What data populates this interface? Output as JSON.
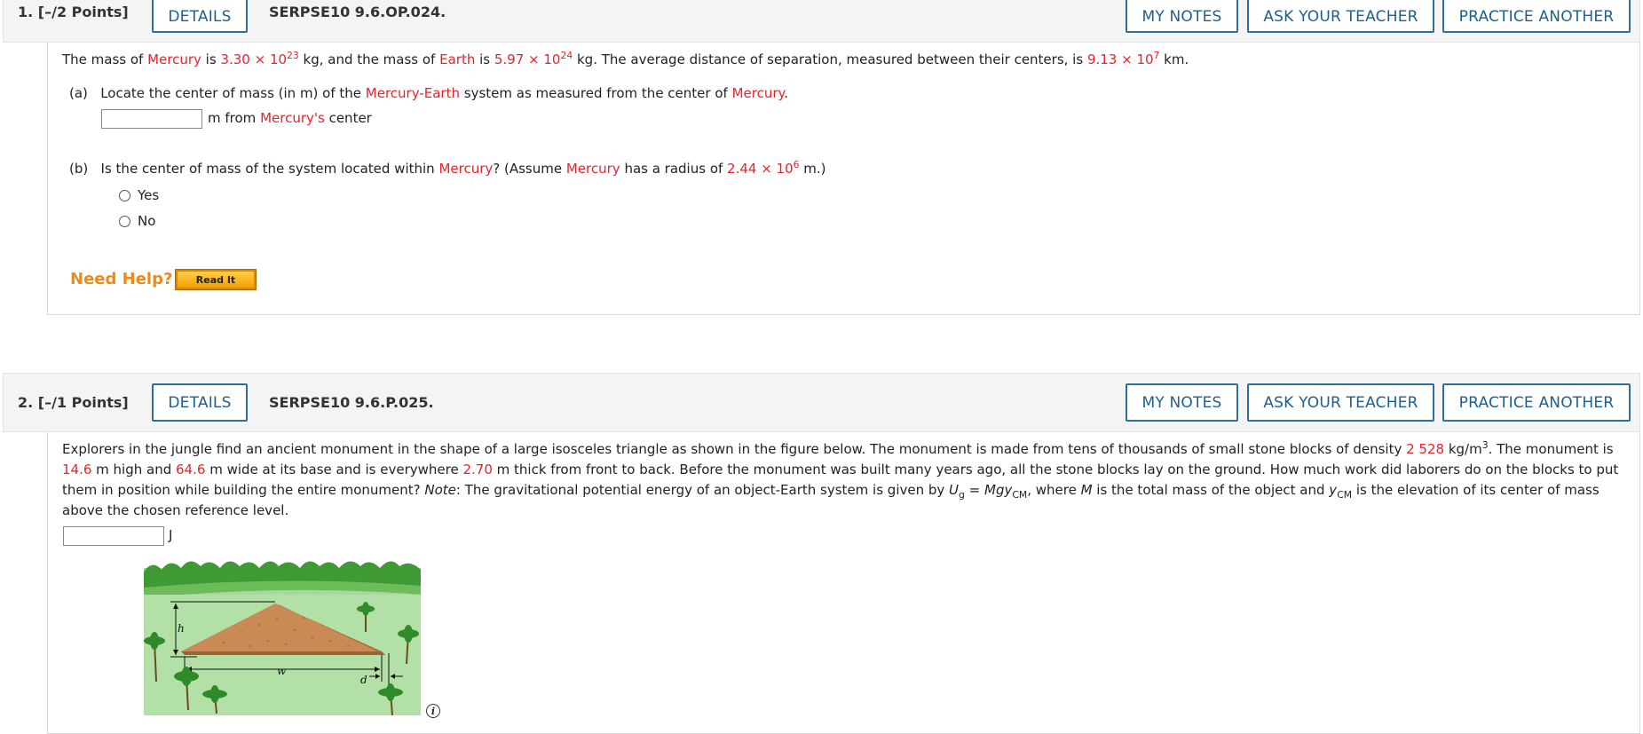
{
  "q1": {
    "number": "1.",
    "points": "[–/2 Points]",
    "details_label": "DETAILS",
    "code": "SERPSE10 9.6.OP.024.",
    "my_notes_label": "MY NOTES",
    "ask_teacher_label": "ASK YOUR TEACHER",
    "practice_label": "PRACTICE ANOTHER",
    "intro": {
      "t1": "The mass of ",
      "mercury": "Mercury",
      "t2": " is ",
      "m_mercury_base": "3.30 × 10",
      "m_mercury_exp": "23",
      "t3": " kg, and the mass of ",
      "earth": "Earth",
      "t4": " is ",
      "m_earth_base": "5.97 × 10",
      "m_earth_exp": "24",
      "t5": " kg. The average distance of separation, measured between their centers, is ",
      "dist_base": "9.13 × 10",
      "dist_exp": "7",
      "t6": " km."
    },
    "part_a": {
      "label": "(a)",
      "t1": "Locate the center of mass (in m) of the ",
      "mercury": "Mercury",
      "dash": "-",
      "earth": "Earth",
      "t2": " system as measured from the center of ",
      "mercury2": "Mercury",
      "t3": ".",
      "answer_value": "",
      "after1": "m from ",
      "after_red": "Mercury's",
      "after2": " center"
    },
    "part_b": {
      "label": "(b)",
      "t1": "Is the center of mass of the system located within ",
      "mercury": "Mercury",
      "t2": "? (Assume ",
      "mercury2": "Mercury",
      "t3": " has a radius of ",
      "r_base": "2.44 × 10",
      "r_exp": "6",
      "t4": " m.)",
      "options": [
        "Yes",
        "No"
      ]
    },
    "need_help": "Need Help?",
    "read_it": "Read It"
  },
  "q2": {
    "number": "2.",
    "points": "[–/1 Points]",
    "details_label": "DETAILS",
    "code": "SERPSE10 9.6.P.025.",
    "my_notes_label": "MY NOTES",
    "ask_teacher_label": "ASK YOUR TEACHER",
    "practice_label": "PRACTICE ANOTHER",
    "text": {
      "t1": "Explorers in the jungle find an ancient monument in the shape of a large isosceles triangle as shown in the figure below. The monument is made from tens of thousands of small stone blocks of density ",
      "density": "2 528",
      "t2": " kg/m",
      "t2_exp": "3",
      "t3": ". The monument is ",
      "height": "14.6",
      "t4": " m high and ",
      "width": "64.6",
      "t5": " m wide at its base and is everywhere ",
      "thickness": "2.70",
      "t6": " m thick from front to back. Before the monument was built many years ago, all the stone blocks lay on the ground. How much work did laborers do on the blocks to put them in position while building the entire monument? ",
      "note": "Note",
      "t7": ": The gravitational potential energy of an object-Earth system is given by ",
      "u": "U",
      "u_sub": "g",
      "eq": " = ",
      "mgy": "Mgy",
      "cm_sub": "CM",
      "t8": ", where ",
      "m": "M",
      "t9": " is the total mass of the object and ",
      "y": "y",
      "y_sub": "CM",
      "t10": " is the elevation of its center of mass above the chosen reference level."
    },
    "answer_value": "",
    "answer_unit": "J",
    "figure_labels": {
      "h": "h",
      "w": "w",
      "d": "d"
    },
    "info_icon": "i"
  },
  "colors": {
    "accent": "#1f5f8b",
    "highlight": "#e8232a",
    "help": "#ef8a16"
  }
}
